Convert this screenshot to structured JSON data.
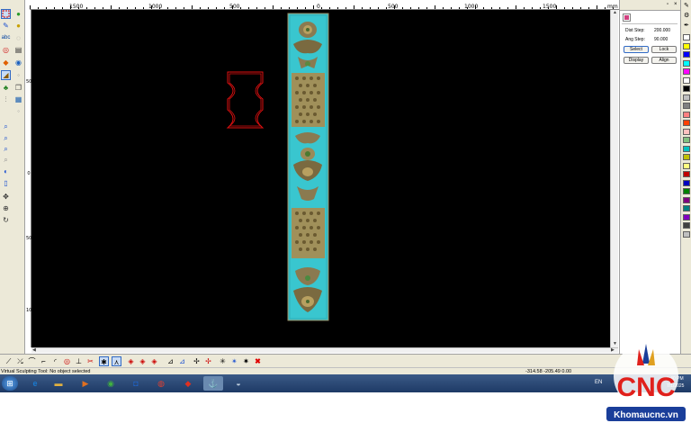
{
  "top_ruler": {
    "labels": [
      {
        "text": "1500"
      },
      {
        "text": "1000"
      },
      {
        "text": "500"
      },
      {
        "text": "0"
      },
      {
        "text": "500"
      },
      {
        "text": "1000"
      },
      {
        "text": "1500"
      }
    ],
    "unit": "mm"
  },
  "left_ruler": {
    "labels": [
      "500",
      "0",
      "500",
      "1000"
    ]
  },
  "right_panel": {
    "dist_step_label": "Dist Step:",
    "dist_step_value": "200.000",
    "ang_step_label": "Ang Step:",
    "ang_step_value": "90.000",
    "select_button": "Select",
    "lock_button": "Lock",
    "display_button": "Display",
    "align_button": "Align"
  },
  "status": {
    "message": "Virtual Sculpting Tool: No object selected",
    "coords": "-314.58 -205.49 0.00"
  },
  "taskbar": {
    "language": "EN",
    "time": "3:40 PM",
    "date": "7/1/2025"
  },
  "logo": {
    "brand": "CNC",
    "site": "Khomaucnc.vn"
  },
  "colors": {
    "canvas_bg": "#000000",
    "panel_teal": "#39c6cf",
    "outline_red": "#e01010",
    "toolbar_bg": "#ece9d8",
    "logo_red": "#e0201c",
    "logo_blue": "#1a3e9a"
  },
  "palette": [
    "#ffffff",
    "#ffff00",
    "#0000ff",
    "#00ffff",
    "#ff00ff",
    "#ffffff",
    "#000000",
    "#c0c0c0",
    "#808080",
    "#ff8080",
    "#ff4000",
    "#ffc0c0",
    "#80c080",
    "#00c0c0",
    "#c0c000",
    "#ffff80",
    "#c00000",
    "#0000c0",
    "#008000",
    "#800080",
    "#008080",
    "#8000c0",
    "#404040",
    "#c0c0c0"
  ]
}
